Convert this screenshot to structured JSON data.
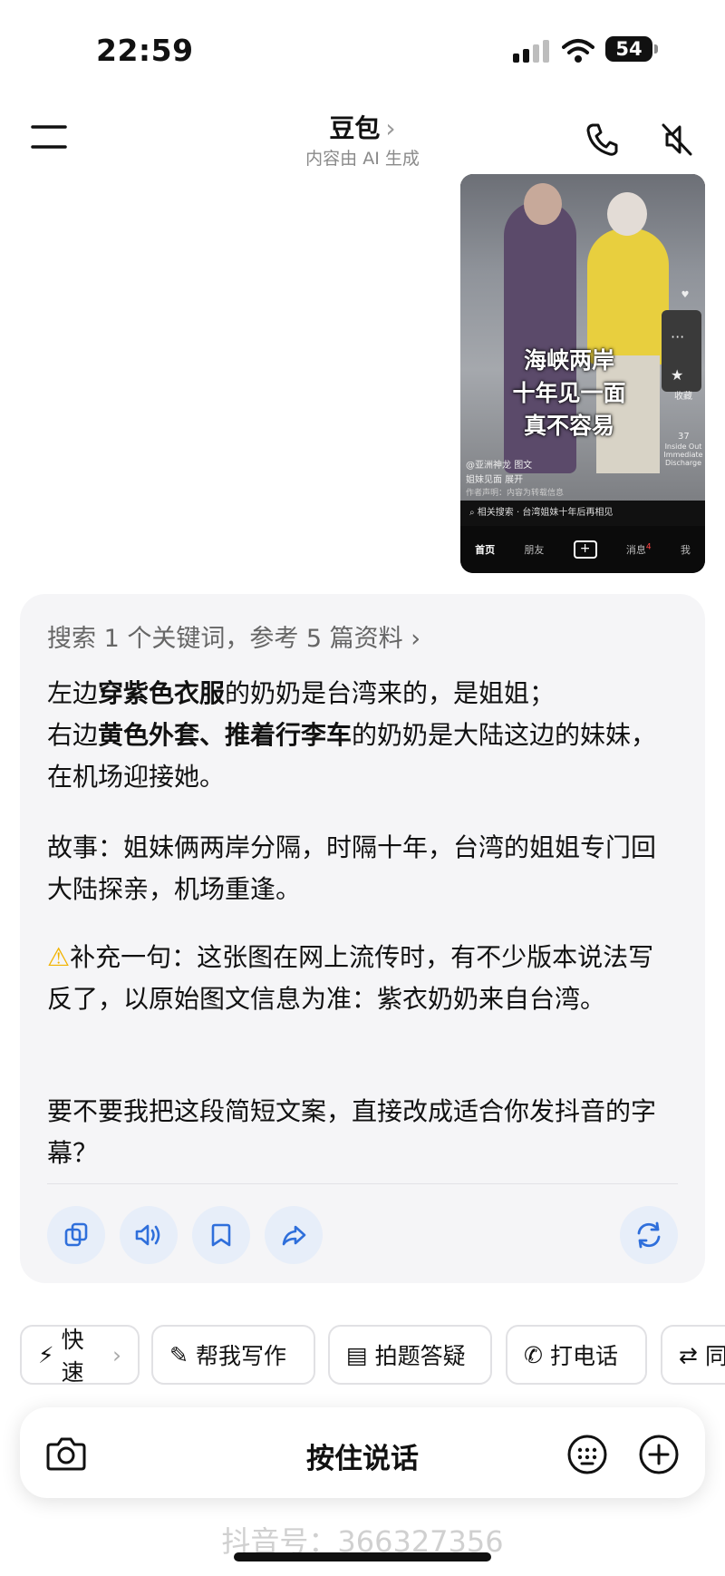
{
  "status": {
    "time": "22:59",
    "battery": "54"
  },
  "header": {
    "title": "豆包",
    "subtitle": "内容由 AI 生成"
  },
  "video": {
    "overlay_lines": [
      "海峡两岸",
      "十年见一面",
      "真不容易"
    ],
    "author": "@亚洲神龙",
    "tag": "图文",
    "caption": "姐妹见面    展开",
    "notice": "作者声明：内容为转载信息",
    "search": "相关搜索 · 台湾姐妹十年后再相见",
    "side_count": "37",
    "side_label": "收藏",
    "side_text": "Inside Out Immediate Discharge",
    "nav": {
      "home": "首页",
      "friends": "朋友",
      "messages": "消息",
      "message_badge": "4",
      "me": "我"
    }
  },
  "answer": {
    "refs": "搜索 1 个关键词，参考 5 篇资料",
    "p1_a": "左边",
    "p1_b": "穿紫色衣服",
    "p1_c": "的奶奶是台湾来的，是姐姐；",
    "p1_d": "右边",
    "p1_e": "黄色外套、推着行李车",
    "p1_f": "的奶奶是大陆这边的妹妹，在机场迎接她。",
    "p2": "故事：姐妹俩两岸分隔，时隔十年，台湾的姐姐专门回大陆探亲，机场重逢。",
    "p3": "补充一句：这张图在网上流传时，有不少版本说法写反了，以原始图文信息为准：紫衣奶奶来自台湾。",
    "p4": "要不要我把这段简短文案，直接改成适合你发抖音的字幕？"
  },
  "chips": {
    "fast": "快速",
    "write": "帮我写作",
    "photo": "拍题答疑",
    "call": "打电话",
    "more": "同"
  },
  "input": {
    "hold_to_talk": "按住说话"
  },
  "watermark": "抖音号：366327356",
  "colors": {
    "accent": "#2f6fdb",
    "action_bg": "#e7eef9",
    "card_bg": "#f5f5f7"
  }
}
